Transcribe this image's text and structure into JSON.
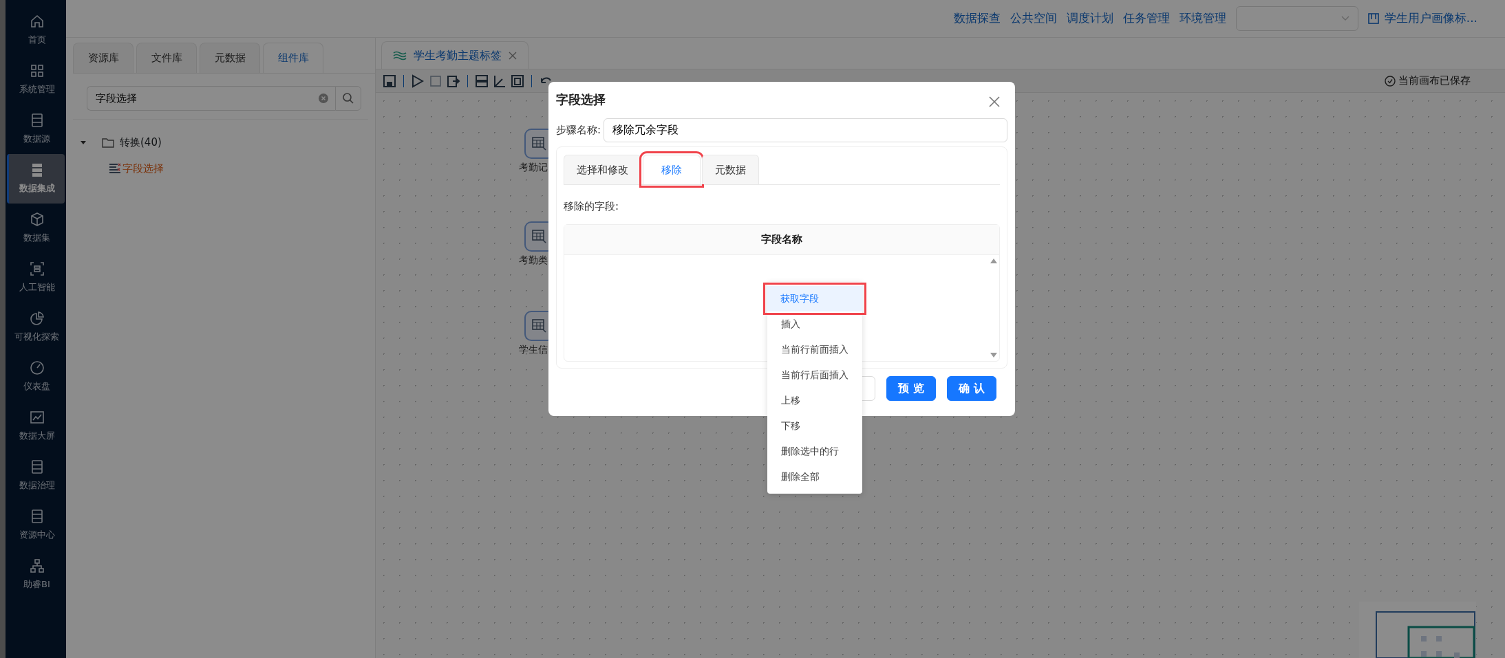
{
  "sidebar": {
    "items": [
      {
        "label": "首页",
        "selected": false
      },
      {
        "label": "系统管理",
        "selected": false
      },
      {
        "label": "数据源",
        "selected": false
      },
      {
        "label": "数据集成",
        "selected": true
      },
      {
        "label": "数据集",
        "selected": false
      },
      {
        "label": "人工智能",
        "selected": false
      },
      {
        "label": "可视化探索",
        "selected": false
      },
      {
        "label": "仪表盘",
        "selected": false
      },
      {
        "label": "数据大屏",
        "selected": false
      },
      {
        "label": "数据治理",
        "selected": false
      },
      {
        "label": "资源中心",
        "selected": false
      },
      {
        "label": "助睿BI",
        "selected": false
      }
    ]
  },
  "top_nav": {
    "links": [
      "数据探查",
      "公共空间",
      "调度计划",
      "任务管理",
      "环境管理"
    ],
    "project": "学生用户画像标..."
  },
  "left_panel": {
    "tabs": [
      {
        "label": "资源库",
        "selected": false
      },
      {
        "label": "文件库",
        "selected": false
      },
      {
        "label": "元数据",
        "selected": false
      },
      {
        "label": "组件库",
        "selected": true
      }
    ],
    "search": {
      "value": "字段选择"
    },
    "tree": [
      {
        "label": "转换(40)",
        "expanded": true,
        "children": [
          {
            "label": "字段选择",
            "selected": true
          }
        ]
      }
    ]
  },
  "canvas": {
    "tabs": [
      {
        "label": "学生考勤主题标签",
        "selected": true
      }
    ],
    "status": "当前画布已保存",
    "nodes": [
      {
        "label": "考勤记"
      },
      {
        "label": "考勤类"
      },
      {
        "label": "学生信"
      }
    ]
  },
  "dialog": {
    "title": "字段选择",
    "step_name_label": "步骤名称:",
    "step_name": "移除冗余字段",
    "tabs": [
      {
        "label": "选择和修改",
        "selected": false,
        "annotated": false
      },
      {
        "label": "移除",
        "selected": true,
        "annotated": true
      },
      {
        "label": "元数据",
        "selected": false,
        "annotated": false
      }
    ],
    "fields_label": "移除的字段:",
    "table": {
      "columns": [
        "字段名称"
      ]
    },
    "buttons": [
      {
        "kind": "default"
      },
      {
        "label": "预 览",
        "kind": "primary"
      },
      {
        "label": "确 认",
        "kind": "primary"
      }
    ]
  },
  "context_menu": {
    "items": [
      {
        "label": "获取字段",
        "selected": true,
        "annotated": true
      },
      {
        "label": "插入",
        "selected": false,
        "annotated": false
      },
      {
        "label": "当前行前面插入",
        "selected": false,
        "annotated": false
      },
      {
        "label": "当前行后面插入",
        "selected": false,
        "annotated": false
      },
      {
        "label": "上移",
        "selected": false,
        "annotated": false
      },
      {
        "label": "下移",
        "selected": false,
        "annotated": false
      },
      {
        "label": "删除选中的行",
        "selected": false,
        "annotated": false
      },
      {
        "label": "删除全部",
        "selected": false,
        "annotated": false
      }
    ]
  }
}
